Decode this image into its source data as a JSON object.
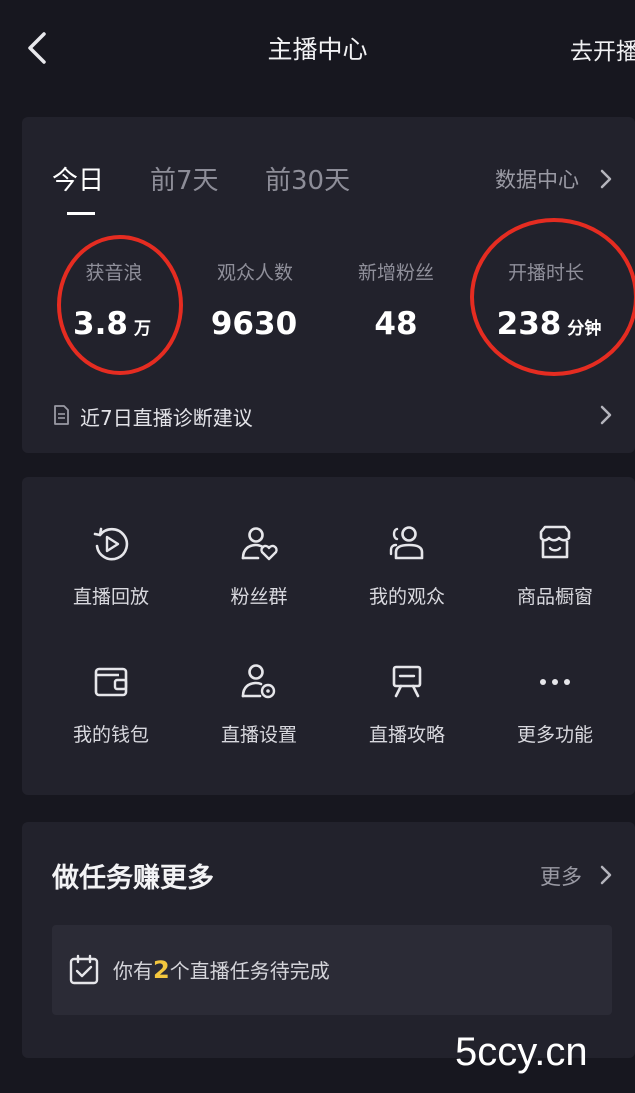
{
  "header": {
    "title": "主播中心",
    "go_live": "去开播",
    "back_icon": "chevron-left-icon"
  },
  "tabs": [
    {
      "label": "今日",
      "active": true
    },
    {
      "label": "前7天",
      "active": false
    },
    {
      "label": "前30天",
      "active": false
    }
  ],
  "data_center": {
    "label": "数据中心"
  },
  "metrics": [
    {
      "label": "获音浪",
      "value": "3.8",
      "unit": "万"
    },
    {
      "label": "观众人数",
      "value": "9630",
      "unit": ""
    },
    {
      "label": "新增粉丝",
      "value": "48",
      "unit": ""
    },
    {
      "label": "开播时长",
      "value": "238",
      "unit": "分钟"
    }
  ],
  "diagnosis": {
    "label": "近7日直播诊断建议",
    "icon": "document-icon"
  },
  "tools": [
    {
      "label": "直播回放",
      "icon": "replay-icon"
    },
    {
      "label": "粉丝群",
      "icon": "fan-group-icon"
    },
    {
      "label": "我的观众",
      "icon": "audience-icon"
    },
    {
      "label": "商品橱窗",
      "icon": "shop-window-icon"
    },
    {
      "label": "我的钱包",
      "icon": "wallet-icon"
    },
    {
      "label": "直播设置",
      "icon": "user-settings-icon"
    },
    {
      "label": "直播攻略",
      "icon": "guide-icon"
    },
    {
      "label": "更多功能",
      "icon": "more-icon"
    }
  ],
  "tasks": {
    "title": "做任务赚更多",
    "more": "更多",
    "text_prefix": "你有",
    "count": "2",
    "text_suffix": "个直播任务待完成",
    "icon": "calendar-check-icon"
  },
  "watermark": "5ccy.cn",
  "colors": {
    "background": "#17171f",
    "card": "#22222c",
    "highlight_circle": "#e52c21",
    "task_count": "#f3c63e"
  }
}
